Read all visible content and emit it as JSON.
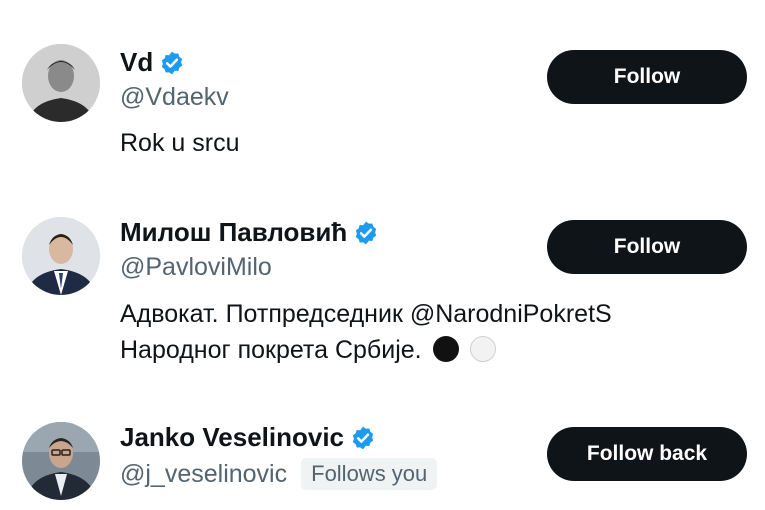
{
  "users": [
    {
      "name": "Vd",
      "handle": "@Vdaekv",
      "bio": "Rok u srcu",
      "button_label": "Follow",
      "verified": true
    },
    {
      "name": "Милош Павловић",
      "handle": "@PavloviMilo",
      "bio_line1": "Адвокат. Потпредседник @NarodniPokretS",
      "bio_line2": "Народног покрета Србије.",
      "bio_emoji": [
        "black-circle",
        "white-circle"
      ],
      "button_label": "Follow",
      "verified": true
    },
    {
      "name": "Janko Veselinovic",
      "handle": "@j_veselinovic",
      "follows_you_label": "Follows you",
      "button_label": "Follow back",
      "verified": true
    }
  ],
  "colors": {
    "verified": "#1d9bf0",
    "button_bg": "#0f1419",
    "button_text": "#ffffff",
    "secondary_text": "#536471",
    "follows_you_bg": "#eff3f4"
  }
}
